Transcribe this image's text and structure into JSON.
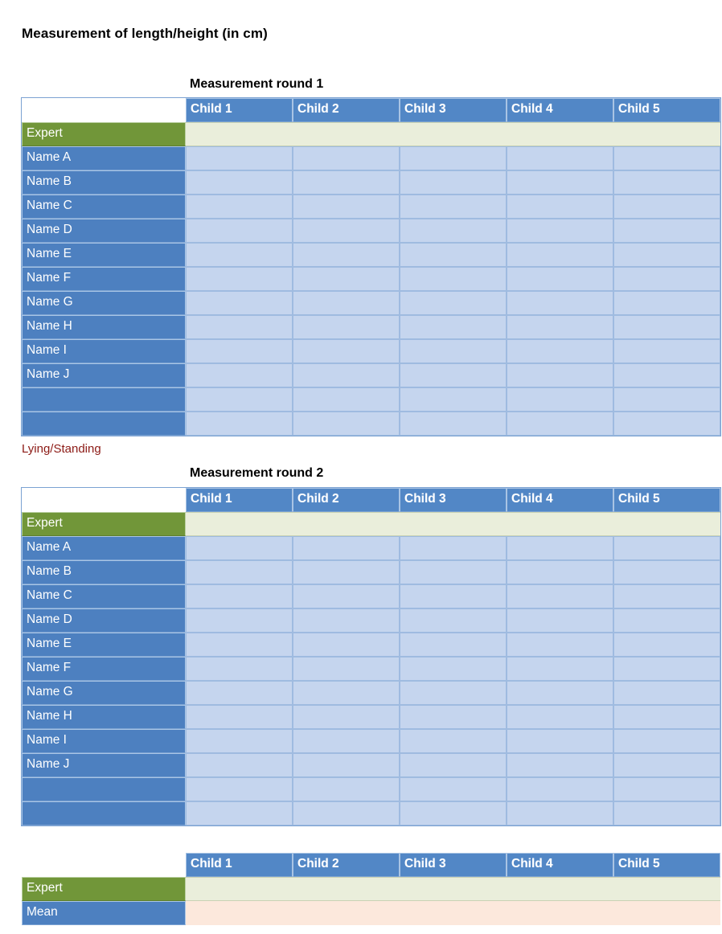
{
  "page": {
    "title": "Measurement of length/height (in cm)",
    "note": "Lying/Standing"
  },
  "columns": [
    "Child 1",
    "Child 2",
    "Child 3",
    "Child 4",
    "Child 5"
  ],
  "labels": {
    "expert": "Expert",
    "mean": "Mean",
    "names": [
      "Name A",
      "Name B",
      "Name C",
      "Name D",
      "Name E",
      "Name F",
      "Name G",
      "Name H",
      "Name I",
      "Name J"
    ],
    "blank": ""
  },
  "rounds": [
    {
      "caption": "Measurement round 1",
      "rows": [
        {
          "label": "Expert",
          "kind": "expert",
          "values": [
            "",
            "",
            "",
            "",
            ""
          ]
        },
        {
          "label": "Name A",
          "kind": "name",
          "values": [
            "",
            "",
            "",
            "",
            ""
          ]
        },
        {
          "label": "Name B",
          "kind": "name",
          "values": [
            "",
            "",
            "",
            "",
            ""
          ]
        },
        {
          "label": "Name C",
          "kind": "name",
          "values": [
            "",
            "",
            "",
            "",
            ""
          ]
        },
        {
          "label": "Name D",
          "kind": "name",
          "values": [
            "",
            "",
            "",
            "",
            ""
          ]
        },
        {
          "label": "Name E",
          "kind": "name",
          "values": [
            "",
            "",
            "",
            "",
            ""
          ]
        },
        {
          "label": "Name F",
          "kind": "name",
          "values": [
            "",
            "",
            "",
            "",
            ""
          ]
        },
        {
          "label": "Name G",
          "kind": "name",
          "values": [
            "",
            "",
            "",
            "",
            ""
          ]
        },
        {
          "label": "Name H",
          "kind": "name",
          "values": [
            "",
            "",
            "",
            "",
            ""
          ]
        },
        {
          "label": "Name I",
          "kind": "name",
          "values": [
            "",
            "",
            "",
            "",
            ""
          ]
        },
        {
          "label": "Name J",
          "kind": "name",
          "values": [
            "",
            "",
            "",
            "",
            ""
          ]
        },
        {
          "label": "",
          "kind": "blank",
          "values": [
            "",
            "",
            "",
            "",
            ""
          ]
        },
        {
          "label": "",
          "kind": "blank",
          "values": [
            "",
            "",
            "",
            "",
            ""
          ]
        }
      ]
    },
    {
      "caption": "Measurement round 2",
      "rows": [
        {
          "label": "Expert",
          "kind": "expert",
          "values": [
            "",
            "",
            "",
            "",
            ""
          ]
        },
        {
          "label": "Name A",
          "kind": "name",
          "values": [
            "",
            "",
            "",
            "",
            ""
          ]
        },
        {
          "label": "Name B",
          "kind": "name",
          "values": [
            "",
            "",
            "",
            "",
            ""
          ]
        },
        {
          "label": "Name C",
          "kind": "name",
          "values": [
            "",
            "",
            "",
            "",
            ""
          ]
        },
        {
          "label": "Name D",
          "kind": "name",
          "values": [
            "",
            "",
            "",
            "",
            ""
          ]
        },
        {
          "label": "Name E",
          "kind": "name",
          "values": [
            "",
            "",
            "",
            "",
            ""
          ]
        },
        {
          "label": "Name F",
          "kind": "name",
          "values": [
            "",
            "",
            "",
            "",
            ""
          ]
        },
        {
          "label": "Name G",
          "kind": "name",
          "values": [
            "",
            "",
            "",
            "",
            ""
          ]
        },
        {
          "label": "Name H",
          "kind": "name",
          "values": [
            "",
            "",
            "",
            "",
            ""
          ]
        },
        {
          "label": "Name I",
          "kind": "name",
          "values": [
            "",
            "",
            "",
            "",
            ""
          ]
        },
        {
          "label": "Name J",
          "kind": "name",
          "values": [
            "",
            "",
            "",
            "",
            ""
          ]
        },
        {
          "label": "",
          "kind": "blank",
          "values": [
            "",
            "",
            "",
            "",
            ""
          ]
        },
        {
          "label": "",
          "kind": "blank",
          "values": [
            "",
            "",
            "",
            "",
            ""
          ]
        }
      ]
    }
  ],
  "summary": {
    "caption": "",
    "rows": [
      {
        "label": "Expert",
        "kind": "expert",
        "values": [
          "",
          "",
          "",
          "",
          ""
        ]
      },
      {
        "label": "Mean",
        "kind": "mean",
        "values": [
          "",
          "",
          "",
          "",
          ""
        ]
      }
    ]
  },
  "colors": {
    "header_blue": "#5287c6",
    "name_blue": "#4d80c0",
    "data_blue": "#c5d5ee",
    "expert_green": "#719639",
    "expert_row": "#eaeedb",
    "mean_row": "#fce8dc",
    "note_red": "#8c1a15"
  }
}
